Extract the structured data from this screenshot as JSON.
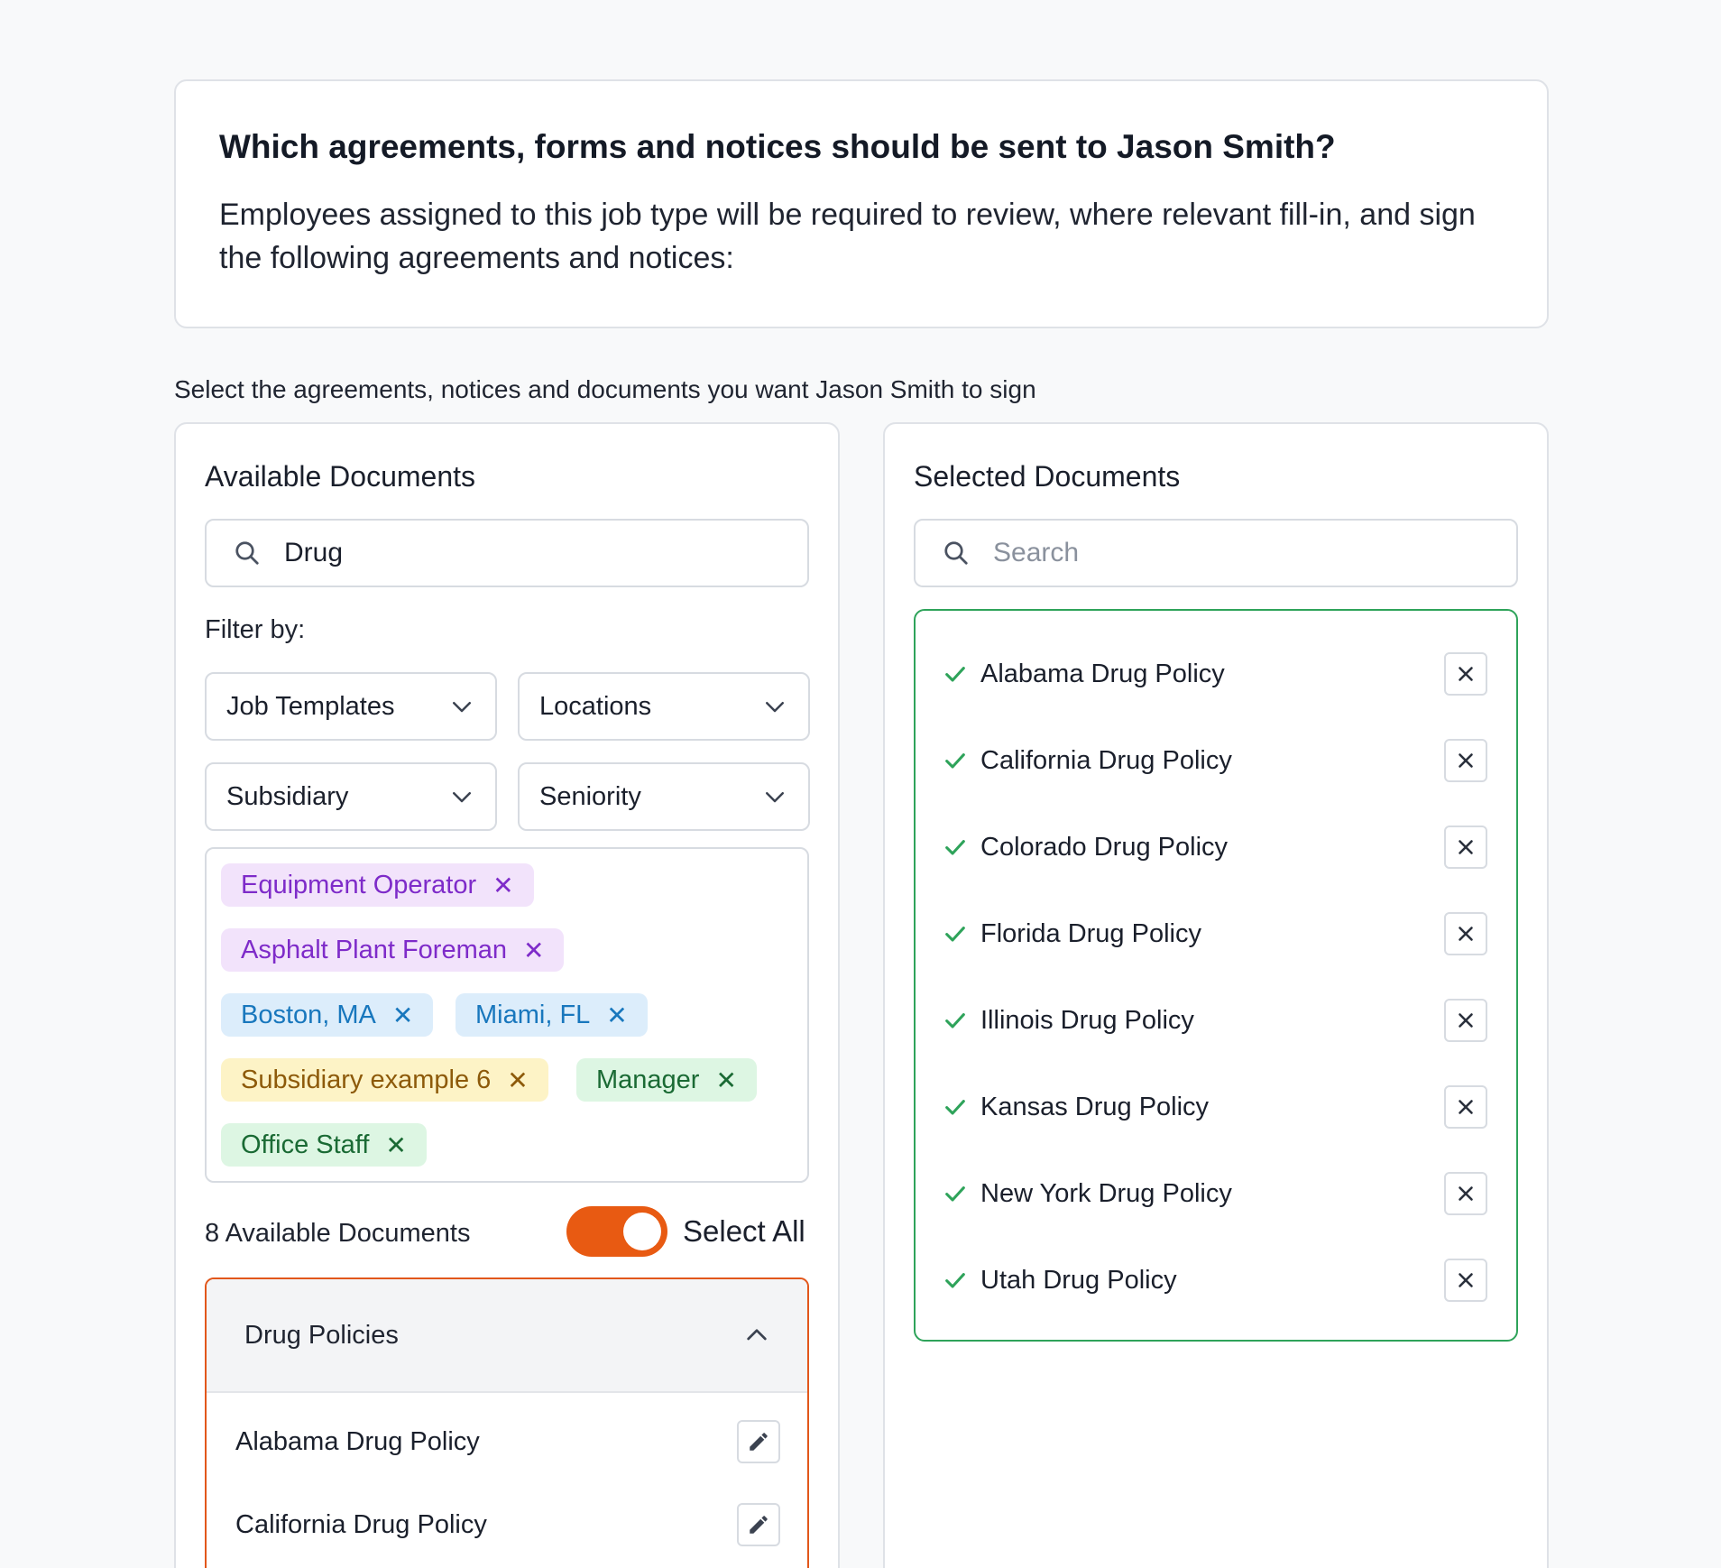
{
  "header": {
    "title": "Which agreements, forms and notices should be sent to Jason Smith?",
    "description": "Employees assigned to this job type will be required to review, where relevant fill-in, and sign the following agreements and notices:"
  },
  "select_prompt": "Select the agreements, notices and documents you want Jason Smith to sign",
  "available": {
    "title": "Available Documents",
    "search_value": "Drug",
    "filter_label": "Filter by:",
    "dropdowns": [
      "Job Templates",
      "Locations",
      "Subsidiary",
      "Seniority"
    ],
    "tags": [
      {
        "label": "Equipment Operator",
        "color": "purple"
      },
      {
        "label": "Asphalt Plant Foreman",
        "color": "purple"
      },
      {
        "label": "Boston, MA",
        "color": "blue"
      },
      {
        "label": "Miami, FL",
        "color": "blue"
      },
      {
        "label": "Subsidiary example 6",
        "color": "yellow"
      },
      {
        "label": "Manager",
        "color": "green"
      },
      {
        "label": "Office Staff",
        "color": "green"
      }
    ],
    "count_label": "8 Available Documents",
    "select_all_label": "Select All",
    "select_all_on": true,
    "group": {
      "title": "Drug Policies",
      "expanded": true,
      "items": [
        "Alabama Drug Policy",
        "California Drug Policy"
      ]
    }
  },
  "selected": {
    "title": "Selected Documents",
    "search_placeholder": "Search",
    "items": [
      "Alabama Drug Policy",
      "California Drug Policy",
      "Colorado Drug Policy",
      "Florida Drug Policy",
      "Illinois Drug Policy",
      "Kansas Drug Policy",
      "New York Drug Policy",
      "Utah Drug Policy"
    ]
  },
  "colors": {
    "accent_orange": "#e85a12",
    "selected_green": "#2ea35a"
  }
}
